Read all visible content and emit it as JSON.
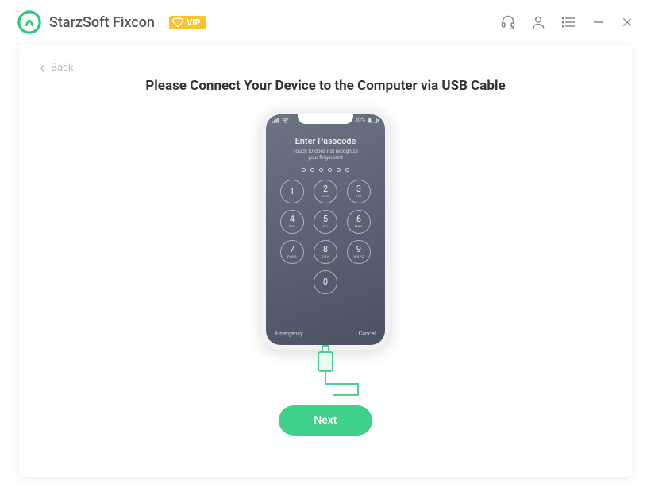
{
  "header": {
    "app_title": "StarzSoft Fixcon",
    "vip_label": "VIP"
  },
  "page": {
    "back_label": "Back",
    "heading": "Please Connect Your Device to the Computer via USB Cable",
    "next_button": "Next"
  },
  "phone": {
    "passcode_title": "Enter Passcode",
    "passcode_subtitle_line1": "Touch ID does not recognize",
    "passcode_subtitle_line2": "your fingerprint",
    "emergency": "Emergency",
    "cancel": "Cancel",
    "battery_pct": "30%",
    "keys": [
      {
        "num": "1",
        "letters": ""
      },
      {
        "num": "2",
        "letters": "ABC"
      },
      {
        "num": "3",
        "letters": "DEF"
      },
      {
        "num": "4",
        "letters": "GHI"
      },
      {
        "num": "5",
        "letters": "JKL"
      },
      {
        "num": "6",
        "letters": "MNO"
      },
      {
        "num": "7",
        "letters": "PQRS"
      },
      {
        "num": "8",
        "letters": "TUV"
      },
      {
        "num": "9",
        "letters": "WXYZ"
      },
      {
        "num": "0",
        "letters": ""
      }
    ]
  },
  "colors": {
    "accent": "#3fd08b",
    "vip": "#f9c332"
  }
}
